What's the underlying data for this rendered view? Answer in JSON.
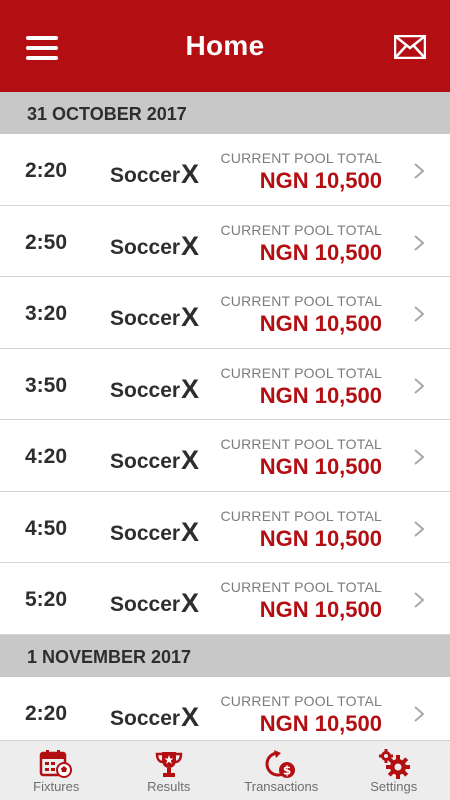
{
  "header": {
    "title": "Home",
    "menu_icon": "hamburger-menu-icon",
    "mail_icon": "envelope-icon"
  },
  "days": [
    {
      "date": "31 OCTOBER 2017",
      "fixtures": [
        {
          "time": "2:20",
          "game_prefix": "Soccer",
          "game_suffix": "X",
          "pool_label": "CURRENT POOL TOTAL",
          "pool_value": "NGN 10,500"
        },
        {
          "time": "2:50",
          "game_prefix": "Soccer",
          "game_suffix": "X",
          "pool_label": "CURRENT POOL TOTAL",
          "pool_value": "NGN 10,500"
        },
        {
          "time": "3:20",
          "game_prefix": "Soccer",
          "game_suffix": "X",
          "pool_label": "CURRENT POOL TOTAL",
          "pool_value": "NGN 10,500"
        },
        {
          "time": "3:50",
          "game_prefix": "Soccer",
          "game_suffix": "X",
          "pool_label": "CURRENT POOL TOTAL",
          "pool_value": "NGN 10,500"
        },
        {
          "time": "4:20",
          "game_prefix": "Soccer",
          "game_suffix": "X",
          "pool_label": "CURRENT POOL TOTAL",
          "pool_value": "NGN 10,500"
        },
        {
          "time": "4:50",
          "game_prefix": "Soccer",
          "game_suffix": "X",
          "pool_label": "CURRENT POOL TOTAL",
          "pool_value": "NGN 10,500"
        },
        {
          "time": "5:20",
          "game_prefix": "Soccer",
          "game_suffix": "X",
          "pool_label": "CURRENT POOL TOTAL",
          "pool_value": "NGN 10,500"
        }
      ]
    },
    {
      "date": "1 NOVEMBER 2017",
      "fixtures": [
        {
          "time": "2:20",
          "game_prefix": "Soccer",
          "game_suffix": "X",
          "pool_label": "CURRENT POOL TOTAL",
          "pool_value": "NGN 10,500"
        }
      ]
    }
  ],
  "tabs": [
    {
      "label": "Fixtures",
      "icon": "calendar-ball-icon"
    },
    {
      "label": "Results",
      "icon": "trophy-icon"
    },
    {
      "label": "Transactions",
      "icon": "money-cycle-icon"
    },
    {
      "label": "Settings",
      "icon": "gears-icon"
    }
  ],
  "colors": {
    "brand_red": "#b30f13",
    "date_header_bg": "#c8c8c8",
    "tabbar_bg": "#ededed"
  }
}
